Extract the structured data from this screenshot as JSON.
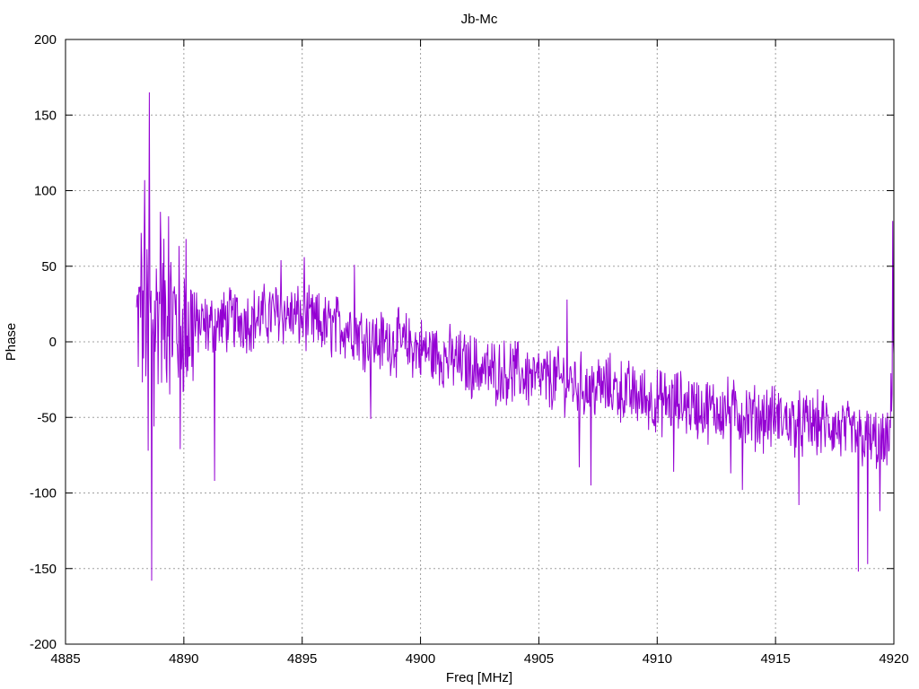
{
  "chart_data": {
    "type": "line",
    "title": "Jb-Mc",
    "xlabel": "Freq [MHz]",
    "ylabel": "Phase",
    "xlim": [
      4885,
      4920
    ],
    "ylim": [
      -200,
      200
    ],
    "xticks": [
      4885,
      4890,
      4895,
      4900,
      4905,
      4910,
      4915,
      4920
    ],
    "yticks": [
      -200,
      -150,
      -100,
      -50,
      0,
      50,
      100,
      150,
      200
    ],
    "grid": true,
    "series": [
      {
        "color": "#9400d3",
        "x_start": 4888.0,
        "x_end": 4920.0,
        "trend_points": [
          [
            4888.0,
            10
          ],
          [
            4888.5,
            15
          ],
          [
            4889.0,
            20
          ],
          [
            4890.0,
            12
          ],
          [
            4891.0,
            10
          ],
          [
            4892.0,
            15
          ],
          [
            4893.0,
            15
          ],
          [
            4894.0,
            20
          ],
          [
            4895.0,
            15
          ],
          [
            4896.0,
            10
          ],
          [
            4897.0,
            10
          ],
          [
            4898.0,
            0
          ],
          [
            4899.0,
            0
          ],
          [
            4900.0,
            -5
          ],
          [
            4901.0,
            -10
          ],
          [
            4902.0,
            -15
          ],
          [
            4903.0,
            -20
          ],
          [
            4904.0,
            -20
          ],
          [
            4905.0,
            -25
          ],
          [
            4906.0,
            -25
          ],
          [
            4907.0,
            -30
          ],
          [
            4908.0,
            -30
          ],
          [
            4909.0,
            -35
          ],
          [
            4910.0,
            -40
          ],
          [
            4911.0,
            -40
          ],
          [
            4912.0,
            -45
          ],
          [
            4913.0,
            -45
          ],
          [
            4914.0,
            -50
          ],
          [
            4915.0,
            -50
          ],
          [
            4916.0,
            -55
          ],
          [
            4917.0,
            -55
          ],
          [
            4918.0,
            -60
          ],
          [
            4919.0,
            -65
          ],
          [
            4919.8,
            -70
          ],
          [
            4920.0,
            0
          ]
        ],
        "peaks": [
          [
            4888.2,
            72
          ],
          [
            4888.35,
            107
          ],
          [
            4888.5,
            -72
          ],
          [
            4888.55,
            165
          ],
          [
            4888.65,
            -158
          ],
          [
            4888.75,
            -56
          ],
          [
            4889.0,
            86
          ],
          [
            4889.35,
            83
          ],
          [
            4889.85,
            -71
          ],
          [
            4890.1,
            68
          ],
          [
            4891.3,
            -92
          ],
          [
            4894.1,
            54
          ],
          [
            4895.1,
            56
          ],
          [
            4897.2,
            51
          ],
          [
            4897.9,
            -51
          ],
          [
            4906.2,
            28
          ],
          [
            4906.7,
            -83
          ],
          [
            4907.2,
            -95
          ],
          [
            4910.7,
            -86
          ],
          [
            4913.1,
            -87
          ],
          [
            4913.6,
            -98
          ],
          [
            4916.0,
            -108
          ],
          [
            4918.5,
            -152
          ],
          [
            4918.9,
            -147
          ],
          [
            4919.4,
            -112
          ],
          [
            4919.95,
            80
          ]
        ]
      }
    ]
  }
}
